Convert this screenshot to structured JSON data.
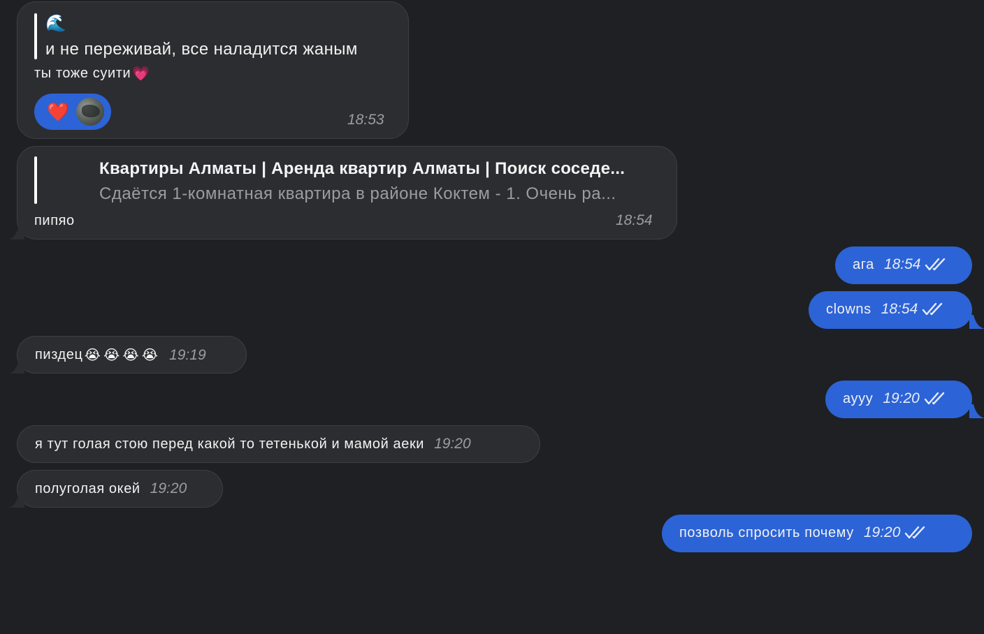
{
  "colors": {
    "background": "#1e2023",
    "incoming_bubble": "#2c2d30",
    "outgoing_bubble": "#2c63d6",
    "timestamp": "#9a9da3"
  },
  "messages": {
    "m1": {
      "quote_emoji": "🌊",
      "quote_text": "и не переживай, все наладится жаным",
      "text": "ты тоже суити",
      "text_emoji": "💗",
      "reaction_emoji": "❤️",
      "time": "18:53"
    },
    "m2": {
      "link_title": "Квартиры Алматы | Аренда квартир Алматы | Поиск соседе...",
      "link_desc": "Сдаётся 1-комнатная квартира в районе Коктем - 1. Очень ра...",
      "text": "пипяо",
      "time": "18:54"
    },
    "m3": {
      "text": "ага",
      "time": "18:54"
    },
    "m4": {
      "text": "clowns",
      "time": "18:54"
    },
    "m5": {
      "text": "пиздец",
      "emojis": "😭😭😭😭",
      "time": "19:19"
    },
    "m6": {
      "text": "аууу",
      "time": "19:20"
    },
    "m7": {
      "text": "я тут голая стою перед какой то тетенькой и мамой аеки",
      "time": "19:20"
    },
    "m8": {
      "text": "полуголая окей",
      "time": "19:20"
    },
    "m9": {
      "text": "позволь спросить почему",
      "time": "19:20"
    }
  }
}
